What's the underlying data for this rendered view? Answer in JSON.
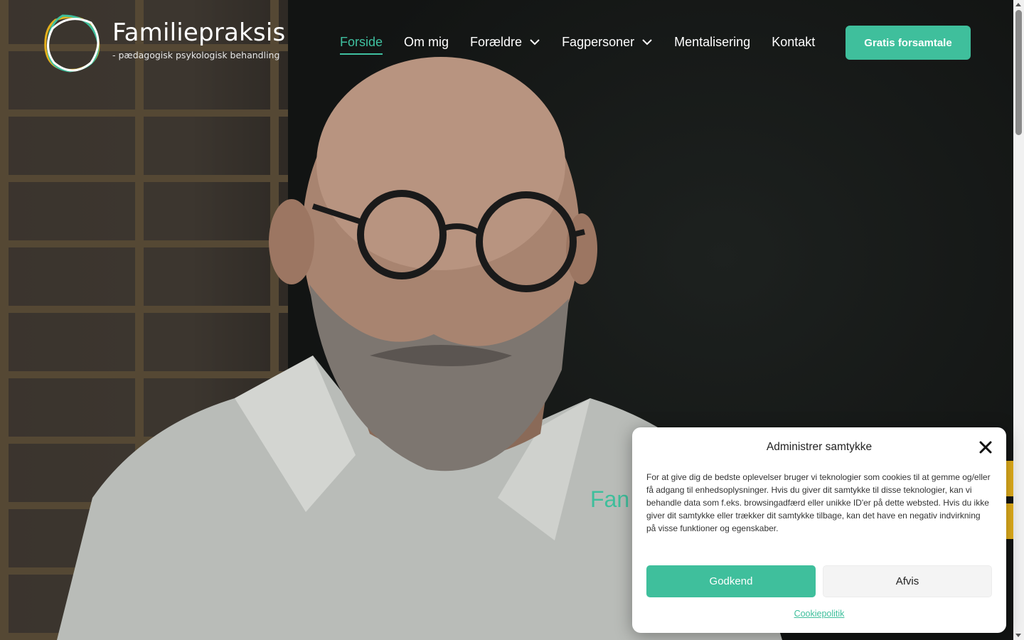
{
  "brand": {
    "title": "Familiepraksis",
    "subtitle": "- pædagogisk psykologisk behandling",
    "logo_colors": [
      "#e5b11c",
      "#3fbf9c",
      "#ffffff"
    ]
  },
  "nav": {
    "items": [
      {
        "label": "Forside",
        "active": true,
        "has_dropdown": false
      },
      {
        "label": "Om mig",
        "active": false,
        "has_dropdown": false
      },
      {
        "label": "Forældre",
        "active": false,
        "has_dropdown": true
      },
      {
        "label": "Fagpersoner",
        "active": false,
        "has_dropdown": true
      },
      {
        "label": "Mentalisering",
        "active": false,
        "has_dropdown": false
      },
      {
        "label": "Kontakt",
        "active": false,
        "has_dropdown": false
      }
    ],
    "cta_label": "Gratis forsamtale"
  },
  "hero": {
    "peek_text": "Fan",
    "accent_color": "#3fbf9c",
    "side_tab_color": "#e5b11c"
  },
  "consent": {
    "title": "Administrer samtykke",
    "body": "For at give dig de bedste oplevelser bruger vi teknologier som cookies til at gemme og/eller få adgang til enhedsoplysninger. Hvis du giver dit samtykke til disse teknologier, kan vi behandle data som f.eks. browsingadfærd eller unikke ID'er på dette websted. Hvis du ikke giver dit samtykke eller trækker dit samtykke tilbage, kan det have en negativ indvirkning på visse funktioner og egenskaber.",
    "accept_label": "Godkend",
    "deny_label": "Afvis",
    "policy_link": "Cookiepolitik"
  }
}
